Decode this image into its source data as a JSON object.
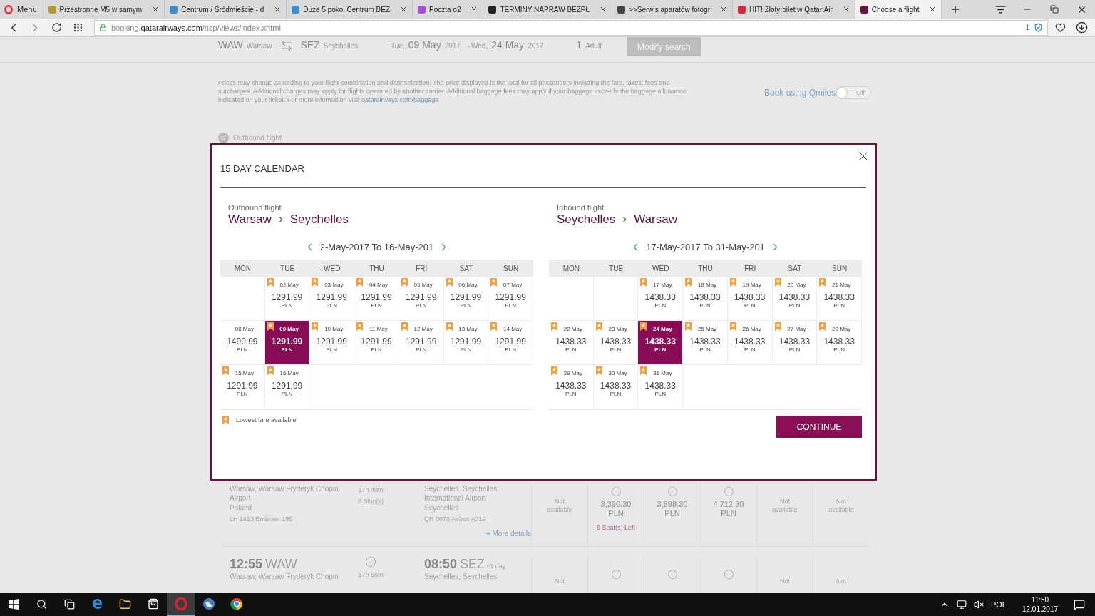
{
  "browser": {
    "menu": "Menu",
    "tabs": [
      {
        "title": "Przestronne M5 w samym",
        "color": "#b59a2e",
        "selected": false
      },
      {
        "title": "Centrum / Śródmieście - d",
        "color": "#3b8fd0",
        "selected": false
      },
      {
        "title": "Duże 5 pokoi Centrum BEZ",
        "color": "#3b8fd0",
        "selected": false
      },
      {
        "title": "Poczta o2",
        "color": "#a64fd8",
        "selected": false
      },
      {
        "title": "TERMINY NAPRAW BEZPŁ",
        "color": "#222222",
        "selected": false
      },
      {
        "title": ">>Serwis aparatów fotogr",
        "color": "#444444",
        "selected": false
      },
      {
        "title": "HIT! Złoty bilet w Qatar Air",
        "color": "#d8263c",
        "selected": false
      },
      {
        "title": "Choose a flight",
        "color": "#6d1242",
        "selected": true
      }
    ],
    "address": {
      "url": "booking.**qatarairways.com**/nsp/views/index.xhtml",
      "badge": "1"
    }
  },
  "search_summary": {
    "origin_code": "WAW",
    "origin": "Warsaw",
    "destination_code": "SEZ",
    "destination": "Seychelles",
    "depart": {
      "weekday": "Tue,",
      "date": "09 May",
      "year": "2017"
    },
    "return": {
      "weekday": "- Wed,",
      "date": "24 May",
      "year": "2017"
    },
    "passengers": {
      "count": "1",
      "label": "Adult"
    },
    "button": "Modify search"
  },
  "notice": {
    "text": "Prices may change according to your flight combination and date selection. The price displayed is the total for all passengers including the fare, taxes, fees and surcharges. Additional charges may apply for flights operated by another carrier. Additional baggage fees may apply if your baggage exceeds the baggage allowance indicated on your ticket. For more information visit ",
    "link": "qatarairways.com/baggage"
  },
  "qmiles": {
    "label": "Book using Qmiles",
    "on": false,
    "state_label": "Off"
  },
  "section_label": "Outbound flight",
  "flights": [
    {
      "depart_place": "Warsaw, Warsaw Fryderyk Chopin Airport",
      "depart_country": "Poland",
      "depart_flight": "LH 1613 Embraer 195",
      "duration": "17h 40m",
      "stops": "2 Stop(s)",
      "arrive_place": "Seychelles, Seychelles International Airport",
      "arrive_country": "Seychelles",
      "arrive_flight": "QR 0678 Airbus A319",
      "details_link": "+ More details",
      "fares": [
        {
          "kind": "unavailable",
          "text": "Not available"
        },
        {
          "kind": "fare",
          "selected": false,
          "price": "3,390.30",
          "currency": "PLN",
          "note": "6 Seat(s) Left"
        },
        {
          "kind": "fare",
          "selected": false,
          "price": "3,598.30",
          "currency": "PLN"
        },
        {
          "kind": "fare",
          "selected": false,
          "price": "4,712.30",
          "currency": "PLN"
        },
        {
          "kind": "unavailable",
          "text": "Not available"
        },
        {
          "kind": "unavailable",
          "text": "Not available"
        }
      ]
    },
    {
      "depart_time": "12:55",
      "depart_code": "WAW",
      "depart_place": "Warsaw, Warsaw Fryderyk Chopin",
      "duration": "17h 55m",
      "arrive_time": "08:50",
      "arrive_code": "SEZ",
      "arrive_next": "+1 day",
      "arrive_place": "Seychelles, Seychelles",
      "fares": [
        {
          "kind": "unavailable",
          "text": "Not"
        },
        {
          "kind": "fare",
          "selected": false
        },
        {
          "kind": "fare",
          "selected": false
        },
        {
          "kind": "fare",
          "selected": false
        },
        {
          "kind": "unavailable",
          "text": "Not"
        },
        {
          "kind": "unavailable",
          "text": "Not"
        }
      ]
    }
  ],
  "calendar_dialog": {
    "title": "15 DAY CALENDAR",
    "legend": "Lowest fare available",
    "button": "CONTINUE",
    "calendars": [
      {
        "label": "Outbound flight",
        "from": "Warsaw",
        "to": "Seychelles",
        "range": "2-May-2017 To 16-May-201",
        "weekdays": [
          "MON",
          "TUE",
          "WED",
          "THU",
          "FRI",
          "SAT",
          "SUN"
        ],
        "weeks": [
          [
            {
              "kind": "blank"
            },
            {
              "kind": "day",
              "date": "02 May",
              "price": "1291.99",
              "currency": "PLN",
              "lowest": true,
              "selected": false
            },
            {
              "kind": "day",
              "date": "03 May",
              "price": "1291.99",
              "currency": "PLN",
              "lowest": true,
              "selected": false
            },
            {
              "kind": "day",
              "date": "04 May",
              "price": "1291.99",
              "currency": "PLN",
              "lowest": true,
              "selected": false
            },
            {
              "kind": "day",
              "date": "05 May",
              "price": "1291.99",
              "currency": "PLN",
              "lowest": true,
              "selected": false
            },
            {
              "kind": "day",
              "date": "06 May",
              "price": "1291.99",
              "currency": "PLN",
              "lowest": true,
              "selected": false
            },
            {
              "kind": "day",
              "date": "07 May",
              "price": "1291.99",
              "currency": "PLN",
              "lowest": true,
              "selected": false
            }
          ],
          [
            {
              "kind": "day",
              "date": "08 May",
              "price": "1499.99",
              "currency": "PLN",
              "lowest": false,
              "selected": false
            },
            {
              "kind": "day",
              "date": "09 May",
              "price": "1291.99",
              "currency": "PLN",
              "lowest": true,
              "selected": true
            },
            {
              "kind": "day",
              "date": "10 May",
              "price": "1291.99",
              "currency": "PLN",
              "lowest": true,
              "selected": false
            },
            {
              "kind": "day",
              "date": "11 May",
              "price": "1291.99",
              "currency": "PLN",
              "lowest": true,
              "selected": false
            },
            {
              "kind": "day",
              "date": "12 May",
              "price": "1291.99",
              "currency": "PLN",
              "lowest": true,
              "selected": false
            },
            {
              "kind": "day",
              "date": "13 May",
              "price": "1291.99",
              "currency": "PLN",
              "lowest": true,
              "selected": false
            },
            {
              "kind": "day",
              "date": "14 May",
              "price": "1291.99",
              "currency": "PLN",
              "lowest": true,
              "selected": false
            }
          ],
          [
            {
              "kind": "day",
              "date": "15 May",
              "price": "1291.99",
              "currency": "PLN",
              "lowest": true,
              "selected": false
            },
            {
              "kind": "day",
              "date": "16 May",
              "price": "1291.99",
              "currency": "PLN",
              "lowest": true,
              "selected": false
            }
          ]
        ]
      },
      {
        "label": "Inbound flight",
        "from": "Seychelles",
        "to": "Warsaw",
        "range": "17-May-2017 To 31-May-201",
        "weekdays": [
          "MON",
          "TUE",
          "WED",
          "THU",
          "FRI",
          "SAT",
          "SUN"
        ],
        "weeks": [
          [
            {
              "kind": "blank"
            },
            {
              "kind": "blank"
            },
            {
              "kind": "day",
              "date": "17 May",
              "price": "1438.33",
              "currency": "PLN",
              "lowest": true,
              "selected": false
            },
            {
              "kind": "day",
              "date": "18 May",
              "price": "1438.33",
              "currency": "PLN",
              "lowest": true,
              "selected": false
            },
            {
              "kind": "day",
              "date": "19 May",
              "price": "1438.33",
              "currency": "PLN",
              "lowest": true,
              "selected": false
            },
            {
              "kind": "day",
              "date": "20 May",
              "price": "1438.33",
              "currency": "PLN",
              "lowest": true,
              "selected": false
            },
            {
              "kind": "day",
              "date": "21 May",
              "price": "1438.33",
              "currency": "PLN",
              "lowest": true,
              "selected": false
            }
          ],
          [
            {
              "kind": "day",
              "date": "22 May",
              "price": "1438.33",
              "currency": "PLN",
              "lowest": true,
              "selected": false
            },
            {
              "kind": "day",
              "date": "23 May",
              "price": "1438.33",
              "currency": "PLN",
              "lowest": true,
              "selected": false
            },
            {
              "kind": "day",
              "date": "24 May",
              "price": "1438.33",
              "currency": "PLN",
              "lowest": true,
              "selected": true
            },
            {
              "kind": "day",
              "date": "25 May",
              "price": "1438.33",
              "currency": "PLN",
              "lowest": true,
              "selected": false
            },
            {
              "kind": "day",
              "date": "26 May",
              "price": "1438.33",
              "currency": "PLN",
              "lowest": true,
              "selected": false
            },
            {
              "kind": "day",
              "date": "27 May",
              "price": "1438.33",
              "currency": "PLN",
              "lowest": true,
              "selected": false
            },
            {
              "kind": "day",
              "date": "28 May",
              "price": "1438.33",
              "currency": "PLN",
              "lowest": true,
              "selected": false
            }
          ],
          [
            {
              "kind": "day",
              "date": "29 May",
              "price": "1438.33",
              "currency": "PLN",
              "lowest": true,
              "selected": false
            },
            {
              "kind": "day",
              "date": "30 May",
              "price": "1438.33",
              "currency": "PLN",
              "lowest": true,
              "selected": false
            },
            {
              "kind": "day",
              "date": "31 May",
              "price": "1438.33",
              "currency": "PLN",
              "lowest": true,
              "selected": false
            }
          ]
        ]
      }
    ]
  },
  "taskbar": {
    "apps": [
      {
        "kind": "start",
        "selected": false
      },
      {
        "kind": "search",
        "selected": false
      },
      {
        "kind": "taskview",
        "selected": false
      },
      {
        "kind": "edge",
        "selected": false
      },
      {
        "kind": "folder",
        "selected": false
      },
      {
        "kind": "store",
        "selected": false
      },
      {
        "kind": "opera",
        "selected": true
      },
      {
        "kind": "app",
        "selected": false
      },
      {
        "kind": "chrome",
        "selected": false
      }
    ],
    "language": "POL",
    "time": "11:50",
    "date": "12.01.2017"
  }
}
